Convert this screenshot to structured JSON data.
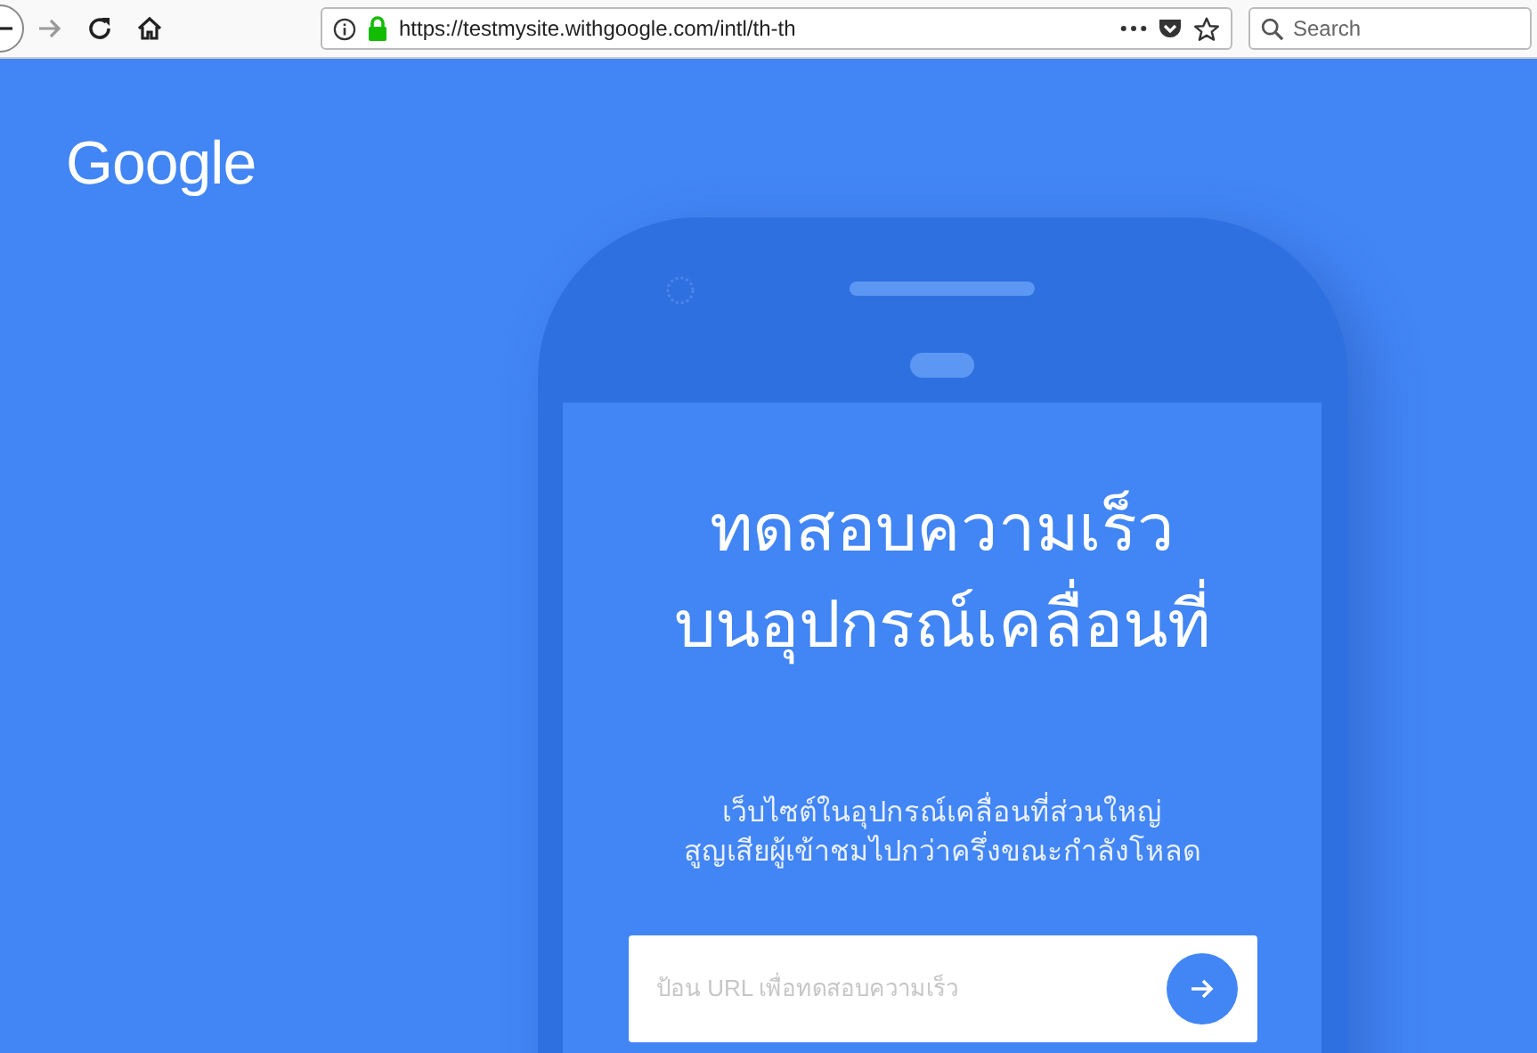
{
  "browser": {
    "back": {
      "disabled": false
    },
    "forward": {
      "disabled": true
    },
    "url": "https://testmysite.withgoogle.com/intl/th-th",
    "search": {
      "placeholder": "Search"
    }
  },
  "logo": "Google",
  "hero": {
    "title_lines": [
      "ทดสอบความเร็ว",
      "บนอุปกรณ์เคลื่อนที่"
    ],
    "subtitle_lines": [
      "เว็บไซต์ในอุปกรณ์เคลื่อนที่ส่วนใหญ่",
      "สูญเสียผู้เข้าชมไปกว่าครึ่งขณะกำลังโหลด"
    ],
    "url_input": {
      "placeholder": "ป้อน URL เพื่อทดสอบความเร็ว"
    }
  }
}
